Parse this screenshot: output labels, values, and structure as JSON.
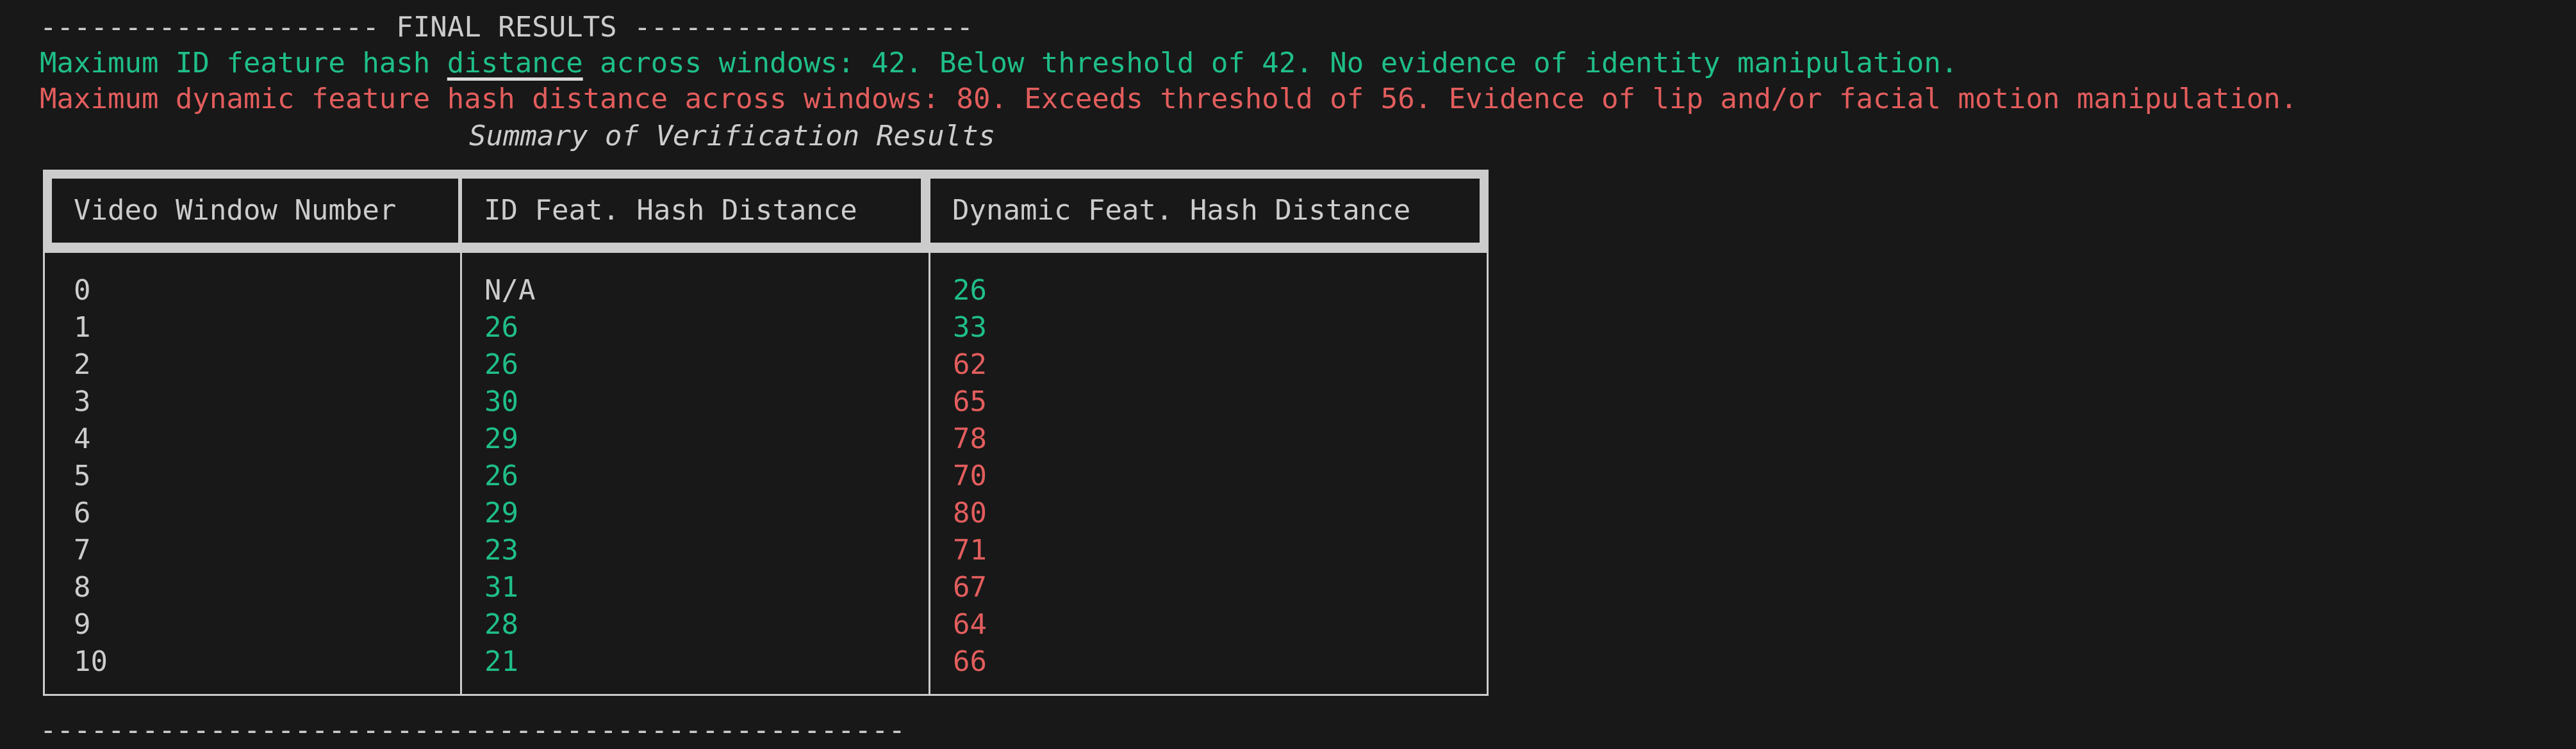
{
  "header_line": "-------------------- FINAL RESULTS --------------------",
  "messages": {
    "id_prefix": "Maximum ID feature hash ",
    "id_underlined": "distance",
    "id_suffix": " across windows: 42. Below threshold of 42. No evidence of identity manipulation.",
    "dynamic": "Maximum dynamic feature hash distance across windows: 80. Exceeds threshold of 56. Evidence of lip and/or facial motion manipulation."
  },
  "table": {
    "title": "Summary of Verification Results",
    "headers": [
      "Video Window Number",
      "ID Feat. Hash Distance",
      "Dynamic Feat. Hash Distance"
    ],
    "rows": [
      {
        "window": "0",
        "id": "N/A",
        "id_status": "neutral",
        "dyn": "26",
        "dyn_status": "pass"
      },
      {
        "window": "1",
        "id": "26",
        "id_status": "pass",
        "dyn": "33",
        "dyn_status": "pass"
      },
      {
        "window": "2",
        "id": "26",
        "id_status": "pass",
        "dyn": "62",
        "dyn_status": "fail"
      },
      {
        "window": "3",
        "id": "30",
        "id_status": "pass",
        "dyn": "65",
        "dyn_status": "fail"
      },
      {
        "window": "4",
        "id": "29",
        "id_status": "pass",
        "dyn": "78",
        "dyn_status": "fail"
      },
      {
        "window": "5",
        "id": "26",
        "id_status": "pass",
        "dyn": "70",
        "dyn_status": "fail"
      },
      {
        "window": "6",
        "id": "29",
        "id_status": "pass",
        "dyn": "80",
        "dyn_status": "fail"
      },
      {
        "window": "7",
        "id": "23",
        "id_status": "pass",
        "dyn": "71",
        "dyn_status": "fail"
      },
      {
        "window": "8",
        "id": "31",
        "id_status": "pass",
        "dyn": "67",
        "dyn_status": "fail"
      },
      {
        "window": "9",
        "id": "28",
        "id_status": "pass",
        "dyn": "64",
        "dyn_status": "fail"
      },
      {
        "window": "10",
        "id": "21",
        "id_status": "pass",
        "dyn": "66",
        "dyn_status": "fail"
      }
    ]
  },
  "footer_line": "---------------------------------------------------",
  "colors": {
    "pass": "#1fbf87",
    "fail": "#e35d5d",
    "neutral": "#cccccc",
    "background": "#181818"
  }
}
